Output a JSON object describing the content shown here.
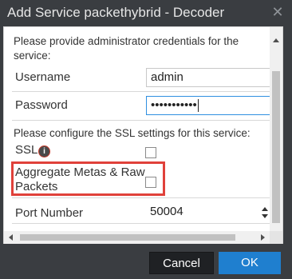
{
  "dialog": {
    "title": "Add Service packethybrid - Decoder",
    "close_symbol": "✕"
  },
  "form": {
    "credentials_prompt_line1": "Please provide administrator credentials for the",
    "credentials_prompt_line2": "service:",
    "username_label": "Username",
    "username_value": "admin",
    "password_label": "Password",
    "password_value": "•••••••••••",
    "ssl_prompt": "Please configure the SSL settings for this service:",
    "ssl_label": "SSL",
    "ssl_info_symbol": "i",
    "ssl_checked": false,
    "aggregate_label_line1": "Aggregate Metas & Raw",
    "aggregate_label_line2": "Packets",
    "aggregate_checked": false,
    "port_label": "Port Number",
    "port_value": "50004"
  },
  "buttons": {
    "cancel_label": "Cancel",
    "ok_label": "OK"
  },
  "colors": {
    "title_bar": "#3a3d41",
    "ok_button": "#1f7fcf",
    "highlight": "#e0413a"
  }
}
